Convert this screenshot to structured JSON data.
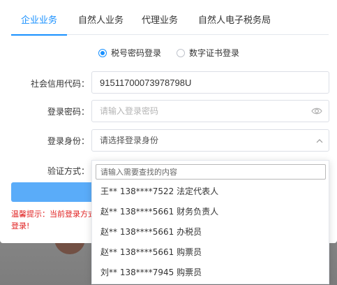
{
  "tabs": [
    {
      "label": "企业业务",
      "active": true
    },
    {
      "label": "自然人业务",
      "active": false
    },
    {
      "label": "代理业务",
      "active": false
    },
    {
      "label": "自然人电子税务局",
      "active": false
    }
  ],
  "login_mode": {
    "options": [
      {
        "label": "税号密码登录",
        "checked": true
      },
      {
        "label": "数字证书登录",
        "checked": false
      }
    ]
  },
  "form": {
    "credit_code": {
      "label": "社会信用代码：",
      "value": "91511700073978798U"
    },
    "password": {
      "label": "登录密码：",
      "placeholder": "请输入登录密码"
    },
    "identity": {
      "label": "登录身份：",
      "value": "请选择登录身份"
    },
    "verify": {
      "label": "验证方式："
    }
  },
  "tip": "温馨提示：当前登录方式登录!",
  "dropdown": {
    "search_placeholder": "请输入需要查找的内容",
    "options": [
      "王** 138****7522 法定代表人",
      "赵** 138****5661 财务负责人",
      "赵** 138****5661 办税员",
      "赵** 138****5661 购票员",
      "刘** 138****7945 购票员"
    ]
  },
  "colors": {
    "accent": "#1890ff",
    "button": "#5aacf9",
    "warning": "#e02020"
  },
  "icons": {
    "password_toggle": "eye-icon",
    "select_arrow": "chevron-down-icon"
  }
}
